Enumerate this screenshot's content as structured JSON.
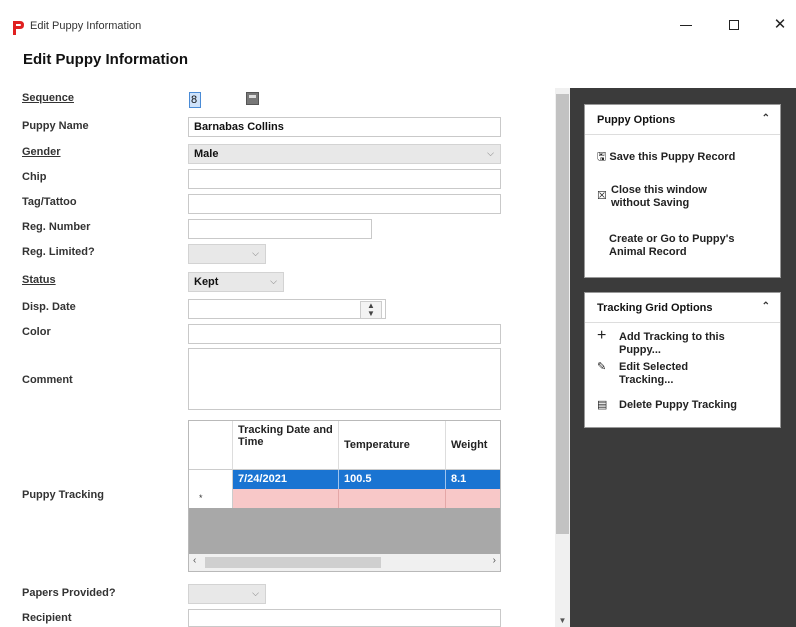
{
  "window": {
    "title": "Edit Puppy Information",
    "minimize": "—",
    "close": "✕"
  },
  "heading": "Edit Puppy Information",
  "form": {
    "sequence_label": "Sequence",
    "sequence_value": "8",
    "puppy_name_label": "Puppy Name",
    "puppy_name_value": "Barnabas Collins",
    "gender_label": "Gender",
    "gender_value": "Male",
    "chip_label": "Chip",
    "tag_label": "Tag/Tattoo",
    "reg_number_label": "Reg. Number",
    "reg_limited_label": "Reg. Limited?",
    "status_label": "Status",
    "status_value": "Kept",
    "disp_date_label": "Disp. Date",
    "color_label": "Color",
    "comment_label": "Comment",
    "puppy_tracking_label": "Puppy Tracking",
    "papers_label": "Papers Provided?",
    "recipient_label": "Recipient"
  },
  "grid": {
    "columns": [
      "Tracking Date and Time",
      "Temperature",
      "Weight"
    ],
    "rows": [
      {
        "date": "7/24/2021",
        "temperature": "100.5",
        "weight": "8.1"
      }
    ],
    "new_row_marker": "*"
  },
  "panel": {
    "puppy_options": {
      "title": "Puppy Options",
      "save": "Save this Puppy Record",
      "close": "Close this window without Saving",
      "create": "Create or Go to Puppy's Animal Record"
    },
    "tracking_options": {
      "title": "Tracking Grid Options",
      "add": "Add Tracking to this Puppy...",
      "edit": "Edit Selected Tracking...",
      "delete": "Delete Puppy Tracking"
    }
  },
  "icons": [
    "app-icon",
    "save-icon",
    "close-window-icon",
    "add-icon",
    "edit-pencil-icon",
    "delete-grid-icon",
    "collapse-icon",
    "chevron-down-icon"
  ],
  "colors": {
    "selection": "#1a74d2",
    "new_row": "#f8c8c8",
    "panel_bg": "#3b3b3b",
    "app_icon": "#e02020"
  }
}
